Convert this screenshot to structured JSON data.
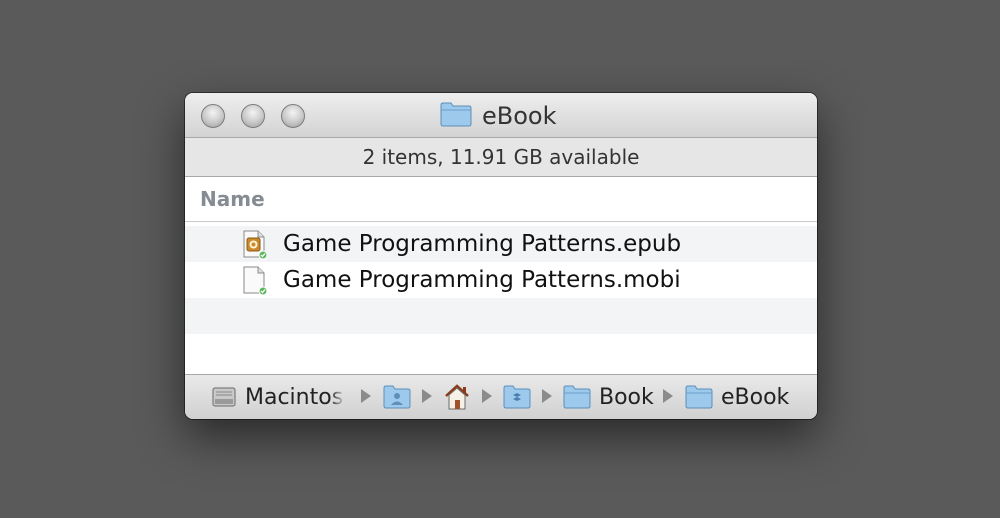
{
  "window": {
    "title": "eBook",
    "title_icon": "folder-icon",
    "traffic_lights": [
      "close",
      "minimize",
      "zoom"
    ]
  },
  "status": {
    "text": "2 items, 11.91 GB available"
  },
  "list": {
    "column_header": "Name",
    "files": [
      {
        "name": "Game Programming Patterns.epub",
        "icon": "epub-file-icon",
        "synced": true
      },
      {
        "name": "Game Programming Patterns.mobi",
        "icon": "document-file-icon",
        "synced": true
      }
    ]
  },
  "path_bar": {
    "items": [
      {
        "label": "Macintosh",
        "icon": "hard-drive-icon"
      },
      {
        "label": "",
        "icon": "user-folder-icon"
      },
      {
        "label": "",
        "icon": "home-icon"
      },
      {
        "label": "",
        "icon": "dropbox-folder-icon"
      },
      {
        "label": "Book",
        "icon": "folder-icon"
      },
      {
        "label": "eBook",
        "icon": "folder-icon"
      }
    ]
  },
  "colors": {
    "desktop": "#5a5a5a",
    "folder_blue": "#8fc3ea",
    "sync_green": "#5cb85c",
    "header_text": "#848b93"
  }
}
